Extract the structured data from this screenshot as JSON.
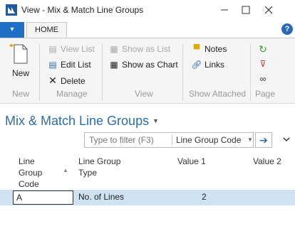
{
  "window": {
    "title": "View - Mix & Match Line Groups"
  },
  "ribbon": {
    "tab": "HOME",
    "groups": {
      "new": {
        "label": "New",
        "items": {
          "new": "New"
        }
      },
      "manage": {
        "label": "Manage",
        "items": {
          "view_list": "View List",
          "edit_list": "Edit List",
          "delete": "Delete"
        }
      },
      "view": {
        "label": "View",
        "items": {
          "show_as_list": "Show as List",
          "show_as_chart": "Show as Chart"
        }
      },
      "show_attached": {
        "label": "Show Attached",
        "items": {
          "notes": "Notes",
          "links": "Links"
        }
      },
      "page": {
        "label": "Page"
      }
    }
  },
  "page": {
    "title": "Mix & Match Line Groups"
  },
  "filter": {
    "placeholder": "Type to filter (F3)",
    "field": "Line Group Code"
  },
  "table": {
    "columns": {
      "code": "Line\nGroup\nCode",
      "type": "Line Group\nType",
      "value1": "Value 1",
      "value2": "Value 2"
    },
    "rows": [
      {
        "code": "A",
        "type": "No. of Lines",
        "value1": "2",
        "value2": ""
      }
    ]
  },
  "colors": {
    "accent": "#2a6db1",
    "selected_row": "#cfe2f3",
    "file_tab": "#1e6fc6"
  }
}
